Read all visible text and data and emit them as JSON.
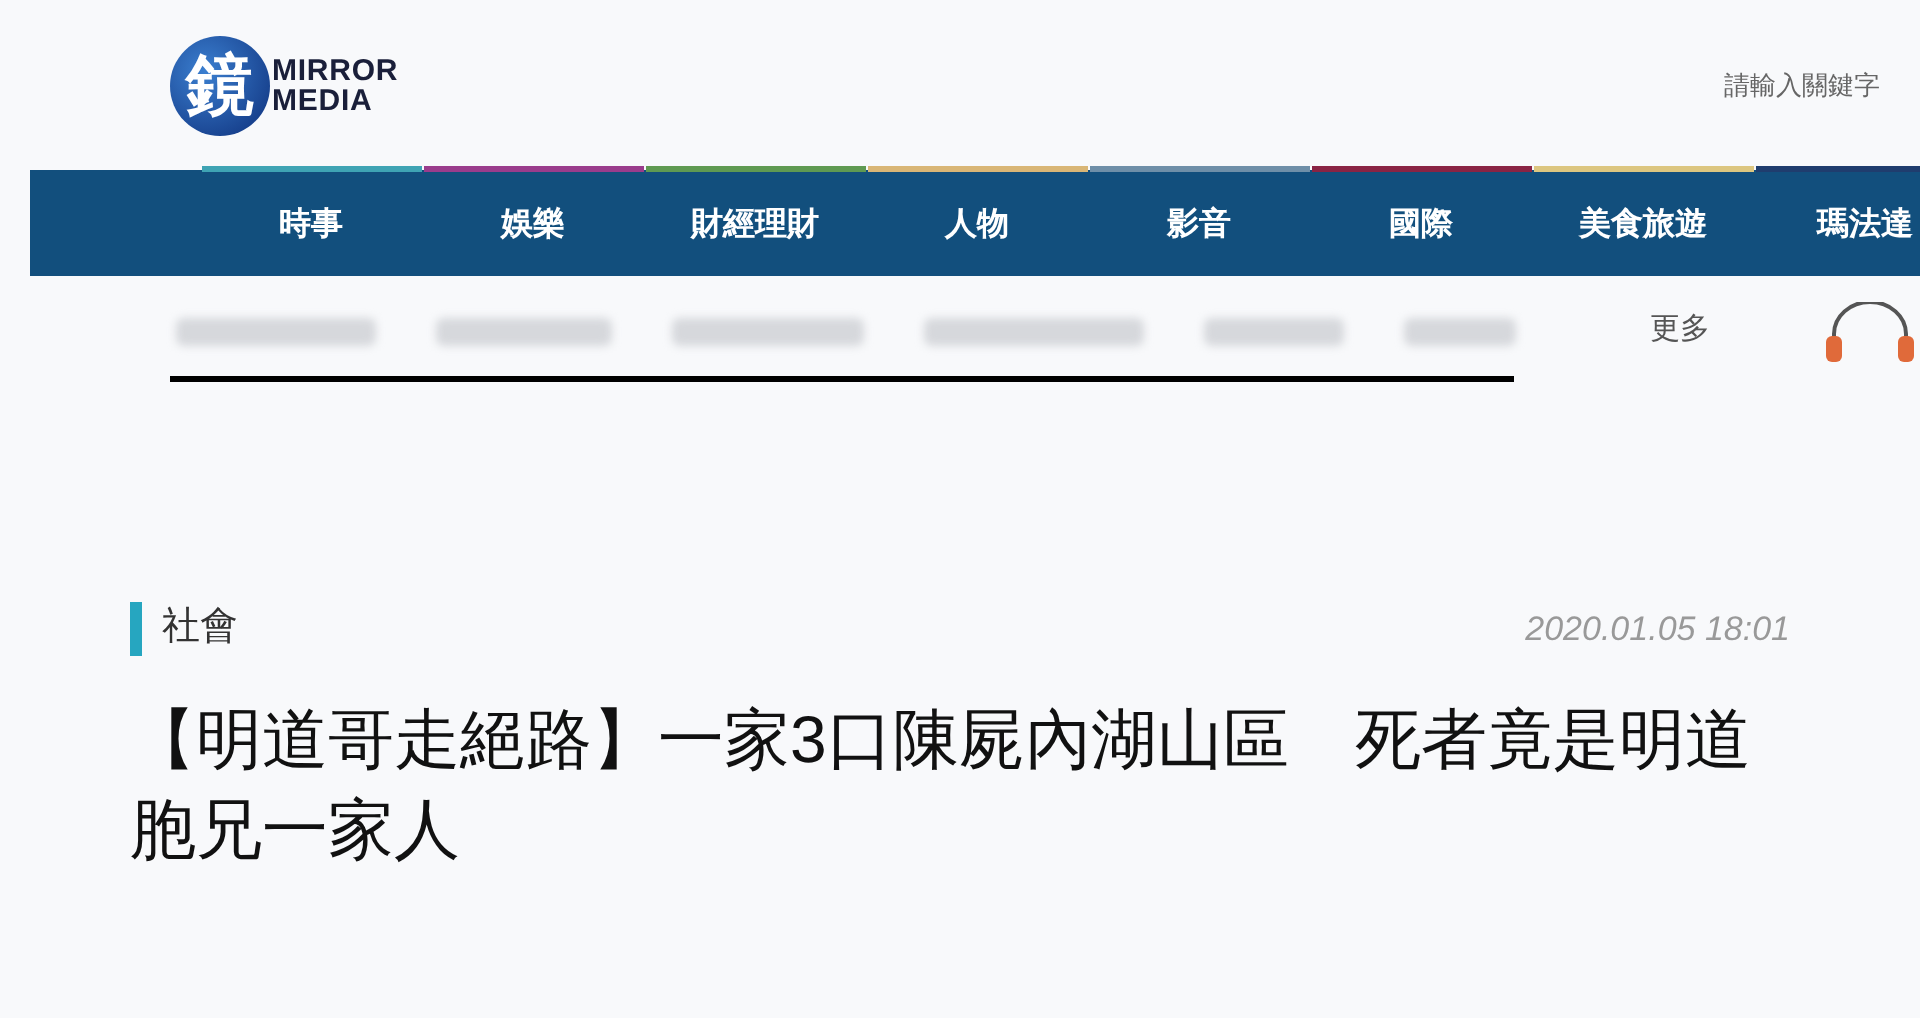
{
  "logo": {
    "mark": "鏡",
    "line_1": "MIRROR",
    "line_2": "MEDIA"
  },
  "search": {
    "placeholder": "請輸入關鍵字"
  },
  "nav": [
    {
      "label": "時事",
      "color": "#3fa4b4"
    },
    {
      "label": "娛樂",
      "color": "#9a3c8c"
    },
    {
      "label": "財經理財",
      "color": "#5f9a52"
    },
    {
      "label": "人物",
      "color": "#d9b676"
    },
    {
      "label": "影音",
      "color": "#6f8fa8"
    },
    {
      "label": "國際",
      "color": "#8a2444"
    },
    {
      "label": "美食旅遊",
      "color": "#dcc680"
    },
    {
      "label": "瑪法達",
      "color": "#1f3d6e"
    }
  ],
  "subnav": {
    "more": "更多"
  },
  "article": {
    "category": "社會",
    "date": "2020.01.05 18:01",
    "title": "【明道哥走絕路】一家3口陳屍內湖山區　死者竟是明道胞兄一家人"
  }
}
